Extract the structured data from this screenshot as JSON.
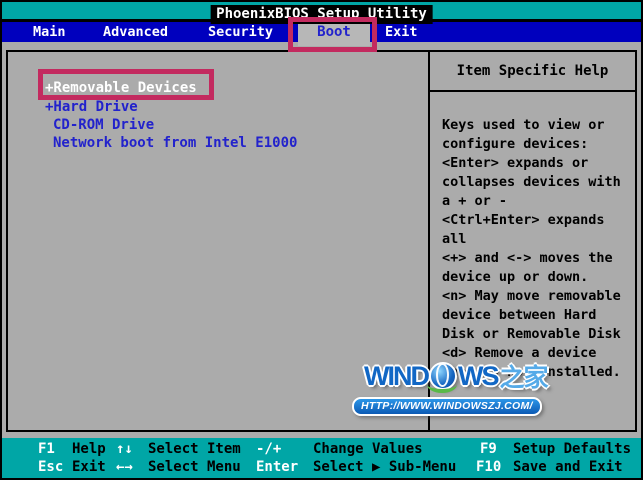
{
  "window": {
    "title": "PhoenixBIOS Setup Utility"
  },
  "menu": {
    "items": [
      {
        "label": "Main",
        "active": false
      },
      {
        "label": "Advanced",
        "active": false
      },
      {
        "label": "Security",
        "active": false
      },
      {
        "label": "Boot",
        "active": true
      },
      {
        "label": "Exit",
        "active": false
      }
    ]
  },
  "boot_menu": {
    "items": [
      {
        "label": "+Removable Devices",
        "selected": true
      },
      {
        "label": "+Hard Drive",
        "selected": false
      },
      {
        "label": "CD-ROM Drive",
        "selected": false
      },
      {
        "label": "Network boot from Intel E1000",
        "selected": false
      }
    ]
  },
  "help_panel": {
    "title": "Item Specific Help",
    "lines": [
      "Keys used to view or",
      "configure devices:",
      "<Enter> expands or",
      "collapses devices with",
      "a + or -",
      "<Ctrl+Enter> expands",
      "all",
      "<+> and <-> moves the",
      "device up or down.",
      "<n> May move removable",
      "device between Hard",
      "Disk or Removable Disk",
      "<d> Remove a device",
      "that is not installed."
    ]
  },
  "footer": {
    "row1": [
      {
        "key": "F1",
        "label": "Help"
      },
      {
        "key": "↑↓",
        "label": "Select Item"
      },
      {
        "key": "-/+",
        "label": "Change Values"
      },
      {
        "key": "F9",
        "label": "Setup Defaults"
      }
    ],
    "row2": [
      {
        "key": "Esc",
        "label": "Exit"
      },
      {
        "key": "←→",
        "label": "Select Menu"
      },
      {
        "key": "Enter",
        "label": "Select ▶ Sub-Menu"
      },
      {
        "key": "F10",
        "label": "Save and Exit"
      }
    ]
  },
  "annotations": {
    "boot_tab_box": "highlight around Boot tab",
    "removable_box": "highlight around +Removable Devices"
  },
  "watermark": {
    "brand_left": "WIND",
    "brand_right": "WS",
    "brand_cn": "之家",
    "globe": "globe-icon",
    "url": "HTTP://WWW.WINDOWSZJ.COM/"
  },
  "colors": {
    "teal_bar": "#00A6A6",
    "menu_blue": "#0000BE",
    "panel_gray": "#ABABAB",
    "item_text_blue": "#2222CC",
    "selected_text": "#FFFFFF",
    "annotation_red": "#C32A5F",
    "watermark_blue": "#1167C5"
  }
}
